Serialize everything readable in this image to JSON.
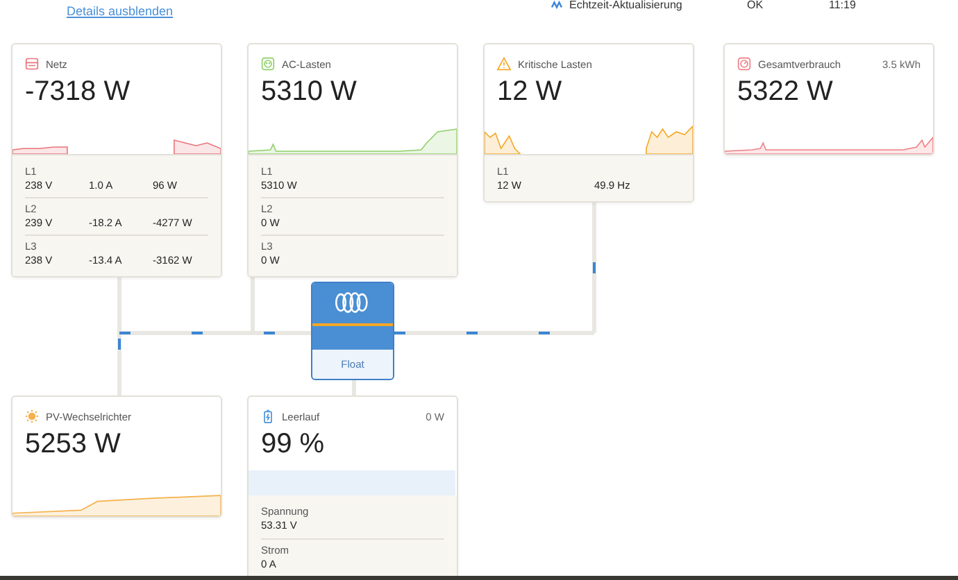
{
  "header": {
    "link": "Details ausblenden",
    "status_label": "Echtzeit-Aktualisierung",
    "status": "OK",
    "time": "11:19"
  },
  "cards": [
    {
      "kind": "grid",
      "title": "Netz",
      "value": "-7318 W",
      "color": "#e8737a",
      "phases": [
        {
          "label": "L1",
          "values": [
            "238 V",
            "1.0 A",
            "96 W"
          ]
        },
        {
          "label": "L2",
          "values": [
            "239 V",
            "-18.2 A",
            "-4277 W"
          ]
        },
        {
          "label": "L3",
          "values": [
            "238 V",
            "-13.4 A",
            "-3162 W"
          ]
        }
      ]
    },
    {
      "kind": "ac_loads",
      "title": "AC-Lasten",
      "value": "5310 W",
      "color": "#8fcf6a",
      "phases": [
        {
          "label": "L1",
          "values": [
            "5310 W"
          ]
        },
        {
          "label": "L2",
          "values": [
            "0 W"
          ]
        },
        {
          "label": "L3",
          "values": [
            "0 W"
          ]
        }
      ]
    },
    {
      "kind": "critical",
      "title": "Kritische Lasten",
      "value": "12 W",
      "color": "#f5a623",
      "phases": [
        {
          "label": "L1",
          "values": [
            "12 W",
            "49.9 Hz"
          ]
        }
      ]
    },
    {
      "kind": "total",
      "title": "Gesamtverbrauch",
      "value": "5322 W",
      "extra": "3.5 kWh",
      "color": "#ee7f85"
    },
    {
      "kind": "pv",
      "title": "PV-Wechselrichter",
      "value": "5253 W",
      "color": "#f5b04a"
    },
    {
      "kind": "battery",
      "title": "Leerlauf",
      "value": "99 %",
      "extra": "0 W",
      "color": "#4a90d9",
      "level": 0.99,
      "details": [
        {
          "label": "Spannung",
          "value": "53.31 V"
        },
        {
          "label": "Strom",
          "value": "0 A"
        }
      ]
    }
  ],
  "inverter": {
    "state": "Float"
  }
}
